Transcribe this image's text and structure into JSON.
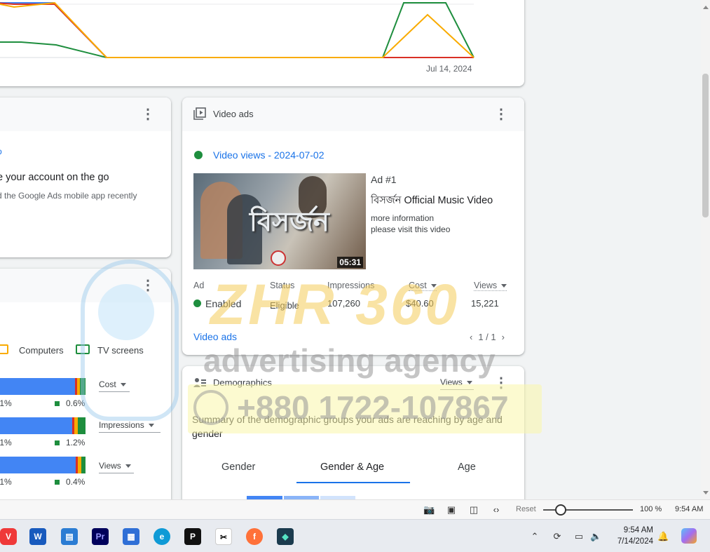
{
  "chart_card": {
    "date_label": "Jul 14, 2024"
  },
  "mobile_card": {
    "link": "p",
    "headline": "e your account on the go",
    "description": "d the Google Ads mobile app recently"
  },
  "devices_card": {
    "legend": [
      {
        "label": "Computers",
        "color": "#f9ab00"
      },
      {
        "label": "TV screens",
        "color": "#1e8e3e"
      }
    ],
    "rows": [
      {
        "left_pct": ".1%",
        "right_pct": "0.6%",
        "metric": "Cost"
      },
      {
        "left_pct": ".1%",
        "right_pct": "1.2%",
        "metric": "Impressions"
      },
      {
        "left_pct": ".1%",
        "right_pct": "0.4%",
        "metric": "Views"
      }
    ]
  },
  "video_card": {
    "title": "Video ads",
    "campaign_link": "Video views - 2024-07-02",
    "thumbnail_overlay": "বিসর্জন",
    "duration": "05:31",
    "ad_number": "Ad #1",
    "ad_title": "বিসর্জন Official Music Video",
    "ad_line1": "more information",
    "ad_line2": "please visit this video",
    "columns": {
      "ad": "Ad",
      "status": "Status",
      "impressions": "Impressions",
      "cost": "Cost",
      "views": "Views"
    },
    "row": {
      "ad": "Enabled",
      "status": "Eligible",
      "impressions": "107,260",
      "cost": "$40.60",
      "views": "15,221"
    },
    "footer_link": "Video ads",
    "pager": "1 / 1"
  },
  "demographics_card": {
    "title": "Demographics",
    "metric": "Views",
    "description": "Summary of the demographic groups your ads are reaching by age and gender",
    "tabs": [
      "Gender",
      "Gender & Age",
      "Age"
    ],
    "active_tab": "Gender & Age"
  },
  "browser_status": {
    "reset": "Reset",
    "zoom": "100 %",
    "time": "9:54 AM"
  },
  "taskbar": {
    "apps": [
      "vivaldi-icon",
      "word-icon",
      "notepad-icon",
      "premiere-icon",
      "store-icon",
      "edge-icon",
      "capcut-pc-icon",
      "capcut-icon",
      "firefox-icon",
      "filmora-icon"
    ],
    "time": "9:54 AM",
    "date": "7/14/2024"
  },
  "watermark": {
    "brand": "ZHR 360",
    "tagline": "advertising agency",
    "phone": "+880 1722-107867"
  },
  "colors": {
    "blue": "#1a73e8",
    "green": "#1e8e3e",
    "orange": "#f9ab00",
    "red": "#d93025",
    "bar_blue": "#4285f4"
  }
}
